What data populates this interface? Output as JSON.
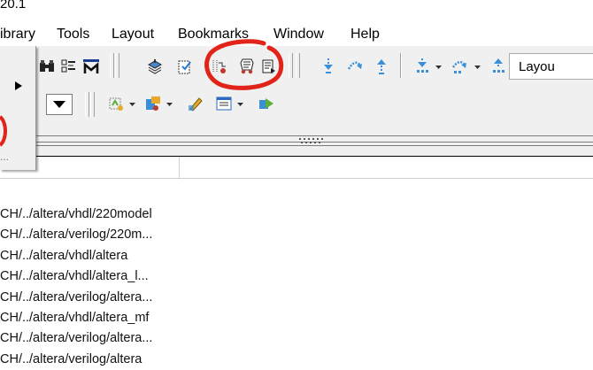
{
  "window": {
    "title_fragment": "20.1"
  },
  "menubar": {
    "items": [
      "ibrary",
      "Tools",
      "Layout",
      "Bookmarks",
      "Window",
      "Help"
    ]
  },
  "toolbar": {
    "layout_label": "Layou",
    "icons": {
      "row1": [
        "binoculars-icon",
        "list-icon",
        "m-icon",
        "compile-icon",
        "compile-all-icon",
        "wave-icon",
        "simulate-icon",
        "break-icon",
        "step-into-icon",
        "step-over-icon",
        "step-out-icon",
        "step-into-dropdown-icon",
        "step-over-dropdown-icon",
        "step-out-dropdown-icon"
      ],
      "row2": [
        "wave-add-icon",
        "wave-tool-icon",
        "edit-icon",
        "list-window-icon",
        "forward-icon"
      ]
    }
  },
  "side_menu": {
    "ellipsis": "..."
  },
  "list": {
    "items": [
      "CH/../altera/vhdl/220model",
      "CH/../altera/verilog/220m...",
      "CH/../altera/vhdl/altera",
      "CH/../altera/vhdl/altera_l...",
      "CH/../altera/verilog/altera...",
      "CH/../altera/vhdl/altera_mf",
      "CH/../altera/verilog/altera...",
      "CH/../altera/verilog/altera"
    ]
  },
  "colors": {
    "annotation_red": "#e2231a",
    "toolbar_bg": "#f0f0f0",
    "step_blue": "#3a8fd8"
  }
}
